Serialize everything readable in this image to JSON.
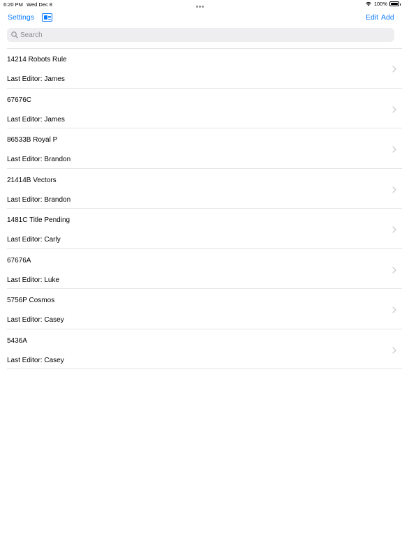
{
  "status_bar": {
    "time": "6:20 PM",
    "date": "Wed Dec 8",
    "battery": "100%"
  },
  "nav": {
    "settings_label": "Settings",
    "edit_label": "Edit",
    "add_label": "Add"
  },
  "search": {
    "placeholder": "Search",
    "value": ""
  },
  "colors": {
    "accent": "#0a7aff",
    "separator": "#e5e5ea",
    "search_bg": "#eeeef0",
    "chevron": "#c4c4c7"
  },
  "icons": {
    "search": "magnifier-icon",
    "row_disclosure": "chevron-right-icon",
    "sidebar_toggle": "sidebar-toggle-icon",
    "wifi": "wifi-icon",
    "battery": "battery-icon"
  },
  "list": {
    "items": [
      {
        "title": "14214 Robots Rule",
        "subtitle": "Last Editor: James"
      },
      {
        "title": "67676C",
        "subtitle": "Last Editor: James"
      },
      {
        "title": "86533B Royal P",
        "subtitle": "Last Editor: Brandon"
      },
      {
        "title": "21414B Vectors",
        "subtitle": "Last Editor: Brandon"
      },
      {
        "title": "1481C Title Pending",
        "subtitle": "Last Editor: Carly"
      },
      {
        "title": "67676A",
        "subtitle": "Last Editor: Luke"
      },
      {
        "title": "5756P Cosmos",
        "subtitle": "Last Editor: Casey"
      },
      {
        "title": "5436A",
        "subtitle": "Last Editor: Casey"
      }
    ]
  }
}
